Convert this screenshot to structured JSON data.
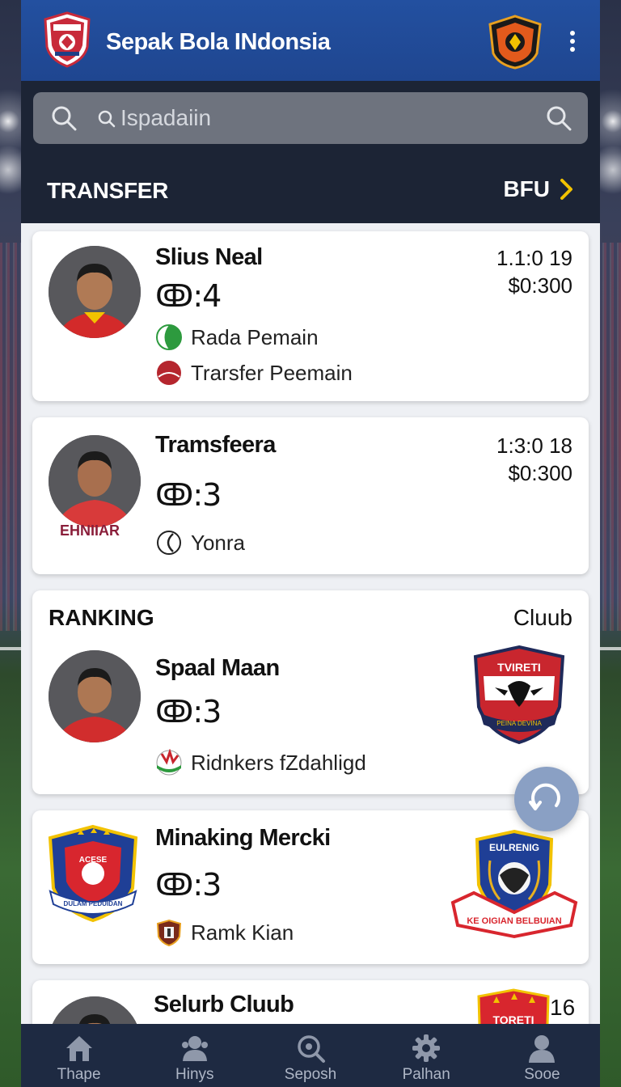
{
  "header": {
    "title": "Sepak Bola INdonsia",
    "app_logo_icon": "club-shield-logo",
    "club_logo_icon": "orange-club-badge",
    "menu_icon": "more-vertical-icon"
  },
  "search": {
    "placeholder": "Ispadaiin",
    "value": ""
  },
  "transfer_section": {
    "title": "TRANSFER",
    "link_label": "BFU"
  },
  "cards": [
    {
      "name": "Slius Neal",
      "score": "ↂ:4",
      "time": "1.1:0 19",
      "price": "$0:300",
      "meta": [
        {
          "icon": "green-ball-icon",
          "label": "Rada Pemain"
        },
        {
          "icon": "red-ball-icon",
          "label": "Trarsfer Peemain"
        }
      ]
    },
    {
      "name": "Tramsfeera",
      "score": "ↂ:3",
      "time": "1:3:0 18",
      "price": "$0:300",
      "jersey_text": "EHNIIAR",
      "meta": [
        {
          "icon": "half-circle-icon",
          "label": "Yonra"
        }
      ]
    },
    {
      "section_left": "RANKING",
      "section_right": "Cluub",
      "name": "Spaal Maan",
      "score": "ↂ:3",
      "meta": [
        {
          "icon": "red-green-ball-icon",
          "label": "Ridnkers fZdahligd"
        }
      ],
      "crest_text": "TVIRETI",
      "crest_banner": "PEINA DEVINA"
    },
    {
      "name": "Minaking Mercki",
      "score": "ↂ:3",
      "meta": [
        {
          "icon": "club-badge-icon",
          "label": "Ramk Kian"
        }
      ],
      "left_crest_text": "ACESE",
      "left_crest_banner": "DULAM PEDUIDAN",
      "right_crest_text": "EULRENIG",
      "right_crest_banner": "KE OIGIAN BELBUIAN"
    },
    {
      "name": "Selurb Cluub",
      "number": "16",
      "crest_text": "TORETI"
    }
  ],
  "bottom_nav": [
    {
      "icon": "home-icon",
      "label": "Thape"
    },
    {
      "icon": "user-group-icon",
      "label": "Hinys"
    },
    {
      "icon": "search-icon",
      "label": "Seposh"
    },
    {
      "icon": "gear-icon",
      "label": "Palhan"
    },
    {
      "icon": "user-icon",
      "label": "Sooe"
    }
  ],
  "colors": {
    "header_blue": "#2350a0",
    "band_dark": "#1c2435",
    "accent_yellow": "#f2c200",
    "nav_dark": "#1e2a42",
    "fab": "#8aa0c4"
  }
}
